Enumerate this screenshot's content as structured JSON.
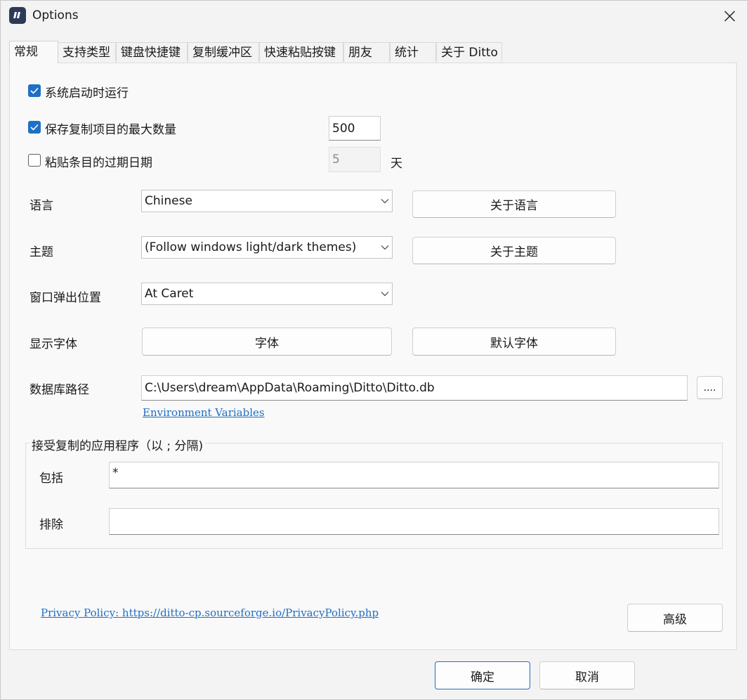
{
  "window": {
    "title": "Options"
  },
  "tabs": [
    {
      "label": "常规"
    },
    {
      "label": "支持类型"
    },
    {
      "label": "键盘快捷键"
    },
    {
      "label": "复制缓冲区"
    },
    {
      "label": "快速粘贴按键"
    },
    {
      "label": "朋友"
    },
    {
      "label": "统计"
    },
    {
      "label": "关于 Ditto"
    }
  ],
  "general": {
    "start_on_boot": {
      "label": "系统启动时运行",
      "checked": true
    },
    "max_items": {
      "label": "保存复制项目的最大数量",
      "checked": true,
      "value": "500"
    },
    "expire": {
      "label": "粘贴条目的过期日期",
      "checked": false,
      "value": "5",
      "unit": "天"
    },
    "language": {
      "label": "语言",
      "value": "Chinese",
      "button": "关于语言"
    },
    "theme": {
      "label": "主题",
      "value": "(Follow windows light/dark themes)",
      "button": "关于主题"
    },
    "popup_position": {
      "label": "窗口弹出位置",
      "value": "At Caret"
    },
    "font": {
      "label": "显示字体",
      "button": "字体",
      "default_button": "默认字体"
    },
    "db_path": {
      "label": "数据库路径",
      "value": "C:\\Users\\dream\\AppData\\Roaming\\Ditto\\Ditto.db",
      "browse": "....",
      "env_link": "Environment Variables"
    },
    "apps_group": {
      "title": "接受复制的应用程序（以 ; 分隔)",
      "include_label": "包括",
      "include_value": "*",
      "exclude_label": "排除",
      "exclude_value": ""
    },
    "privacy_link": "Privacy Policy: https://ditto-cp.sourceforge.io/PrivacyPolicy.php",
    "advanced_button": "高级"
  },
  "footer": {
    "ok": "确定",
    "cancel": "取消"
  },
  "colors": {
    "accent": "#1f6fc5",
    "background": "#f3f3f3",
    "panel": "#f9f9f9",
    "app_icon": "#2c3a5a"
  },
  "icons": [
    "ditto-app-icon",
    "close-icon",
    "checkmark-icon",
    "chevron-down-icon"
  ]
}
